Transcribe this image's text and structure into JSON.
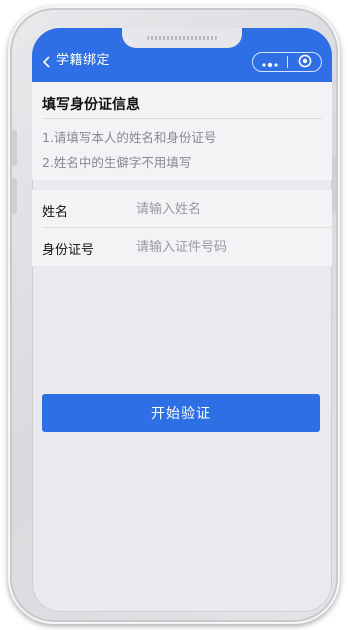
{
  "nav": {
    "title": "学籍绑定",
    "back_icon": "chevron-left-icon",
    "more_icon": "more-dots-icon",
    "close_icon": "target-circle-icon",
    "bg_color": "#2f6fe6"
  },
  "info": {
    "title": "填写身份证信息",
    "tips": [
      "1.请填写本人的姓名和身份证号",
      "2.姓名中的生僻字不用填写"
    ]
  },
  "form": {
    "name": {
      "label": "姓名",
      "placeholder": "请输入姓名",
      "value": ""
    },
    "id": {
      "label": "身份证号",
      "placeholder": "请输入证件号码",
      "value": ""
    }
  },
  "actions": {
    "verify_label": "开始验证",
    "color": "#2f6fe6"
  }
}
